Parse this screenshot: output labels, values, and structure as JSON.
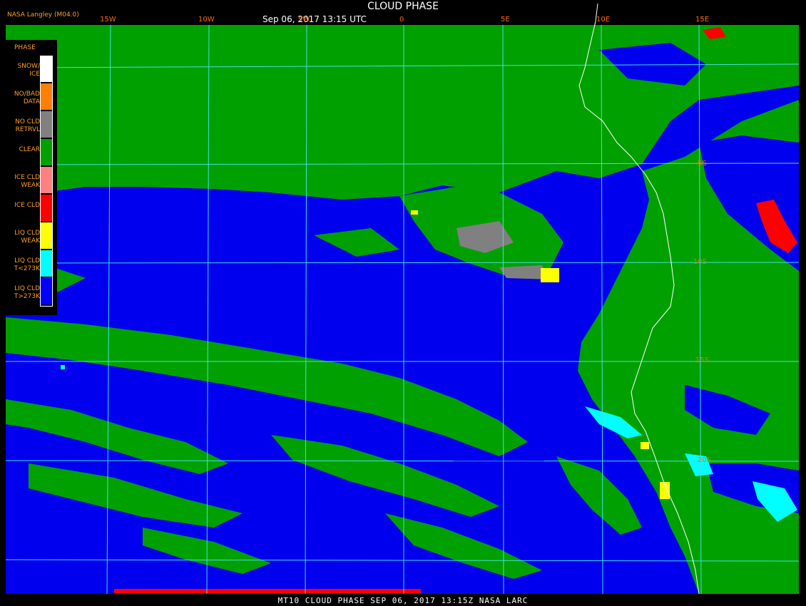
{
  "header": {
    "title": "CLOUD PHASE",
    "date": "Sep 06, 2017 13:15 UTC",
    "org": "NASA Langley (M04.0)"
  },
  "footer": "MT10  CLOUD PHASE   SEP 06, 2017 13:15Z   NASA LARC",
  "lon_labels": [
    "15W",
    "10W",
    "5W",
    "0",
    "5E",
    "10E",
    "15E"
  ],
  "lat_labels": [
    "5S",
    "10S",
    "15S",
    "20S"
  ],
  "legend": {
    "title": "PHASE",
    "items": [
      {
        "label": "SNOW/\nICE",
        "color": "#ffffff"
      },
      {
        "label": "NO/BAD\nDATA",
        "color": "#ff8000"
      },
      {
        "label": "NO CLD\nRETRVL",
        "color": "#808080"
      },
      {
        "label": "CLEAR",
        "color": "#00a000"
      },
      {
        "label": "ICE CLD\nWEAK",
        "color": "#ff8080"
      },
      {
        "label": "ICE CLD",
        "color": "#ff0000"
      },
      {
        "label": "LIQ CLD\nWEAK",
        "color": "#ffff00"
      },
      {
        "label": "LIQ CLD\nT<273K",
        "color": "#00ffff"
      },
      {
        "label": "LIQ CLD\nT>273K",
        "color": "#0000ff"
      }
    ]
  },
  "colors": {
    "liquid_warm": "#0000ee",
    "clear": "#00a000",
    "grid": "#40e0e0",
    "coast": "#ffffff"
  }
}
